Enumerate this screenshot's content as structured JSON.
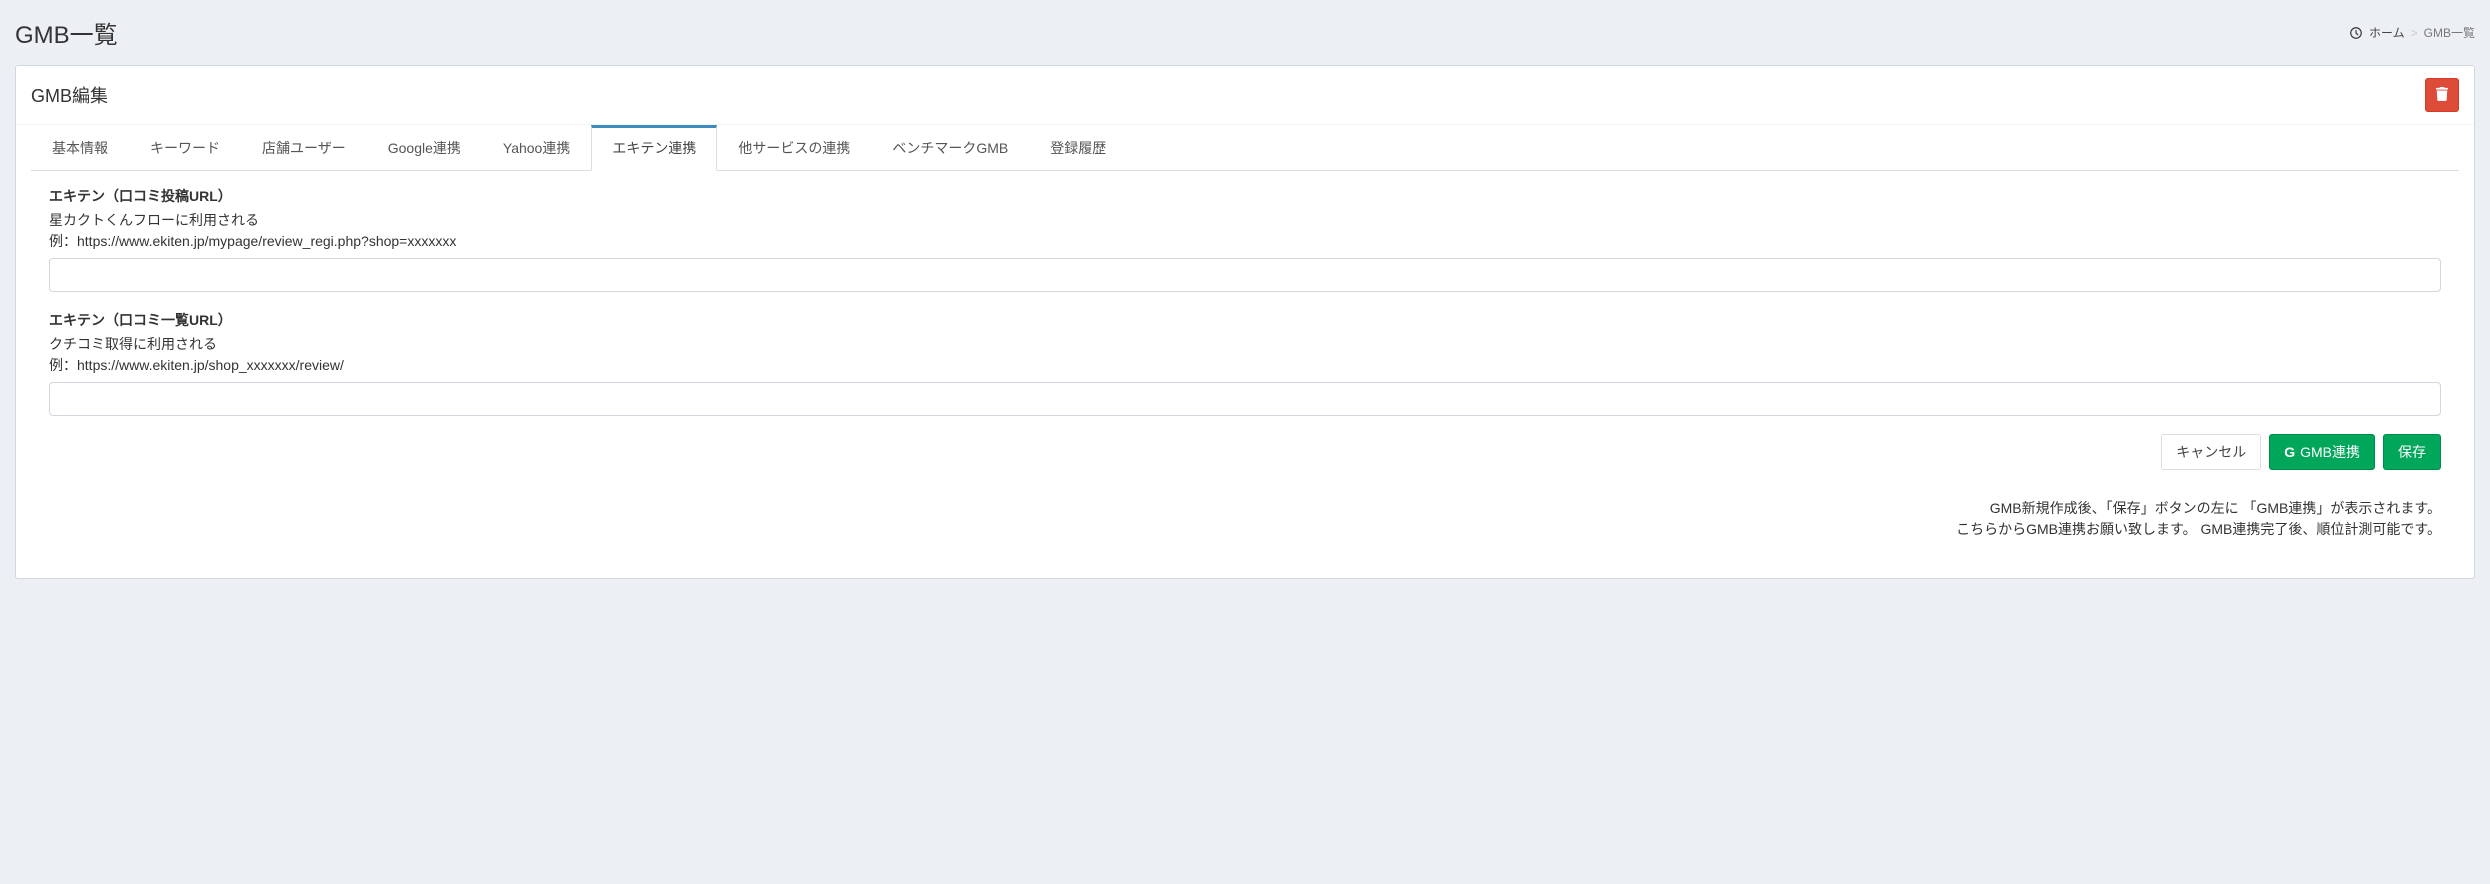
{
  "page": {
    "title": "GMB一覧"
  },
  "breadcrumb": {
    "home": "ホーム",
    "current": "GMB一覧"
  },
  "card": {
    "title": "GMB編集"
  },
  "tabs": [
    {
      "label": "基本情報"
    },
    {
      "label": "キーワード"
    },
    {
      "label": "店舗ユーザー"
    },
    {
      "label": "Google連携"
    },
    {
      "label": "Yahoo連携"
    },
    {
      "label": "エキテン連携",
      "active": true
    },
    {
      "label": "他サービスの連携"
    },
    {
      "label": "ベンチマークGMB"
    },
    {
      "label": "登録履歴"
    }
  ],
  "fields": {
    "review_post": {
      "label": "エキテン（口コミ投稿URL）",
      "help1": "星カクトくんフローに利用される",
      "help2": "例：https://www.ekiten.jp/mypage/review_regi.php?shop=xxxxxxx",
      "value": ""
    },
    "review_list": {
      "label": "エキテン（口コミ一覧URL）",
      "help1": "クチコミ取得に利用される",
      "help2": "例：https://www.ekiten.jp/shop_xxxxxxx/review/",
      "value": ""
    }
  },
  "buttons": {
    "cancel": "キャンセル",
    "gmb_link": "GMB連携",
    "save": "保存"
  },
  "footer_note": {
    "line1": "GMB新規作成後、「保存」ボタンの左に 「GMB連携」が表示されます。",
    "line2": "こちらからGMB連携お願い致します。 GMB連携完了後、順位計測可能です。"
  }
}
